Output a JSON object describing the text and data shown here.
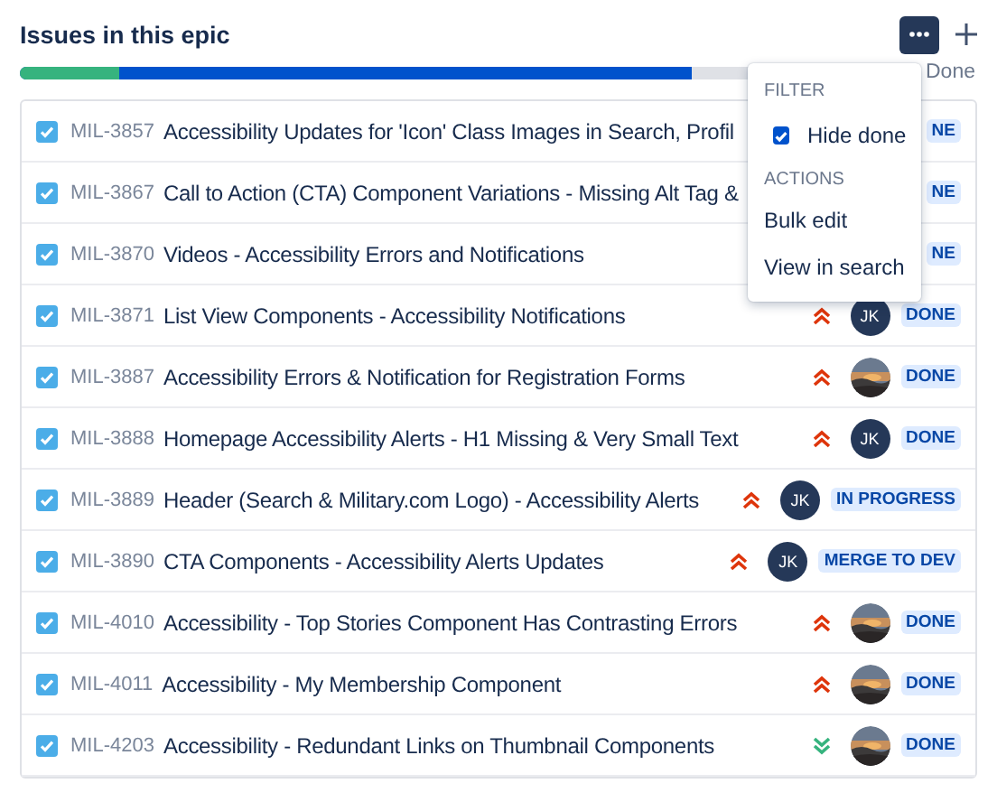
{
  "title": "Issues in this epic",
  "progress": {
    "segments": [
      {
        "kind": "done",
        "level": 0.12
      },
      {
        "kind": "in_progress",
        "level": 0.81
      }
    ],
    "label": "Done"
  },
  "issues": [
    {
      "key": "MIL-3857",
      "summary": "Accessibility Updates for 'Icon' Class Images in Search, Profil",
      "checked": true,
      "status": "NE"
    },
    {
      "key": "MIL-3867",
      "summary": "Call to Action (CTA) Component Variations - Missing Alt Tag &",
      "checked": true,
      "status": "NE"
    },
    {
      "key": "MIL-3870",
      "summary": "Videos - Accessibility Errors and Notifications",
      "checked": true,
      "status": "NE"
    },
    {
      "key": "MIL-3871",
      "summary": "List View Components - Accessibility Notifications",
      "checked": true,
      "priority": {
        "kind": "highest"
      },
      "avatar": {
        "kind": "initials",
        "initials": "JK"
      },
      "status": "DONE"
    },
    {
      "key": "MIL-3887",
      "summary": "Accessibility Errors & Notification for Registration Forms",
      "checked": true,
      "priority": {
        "kind": "highest"
      },
      "status": "DONE"
    },
    {
      "key": "MIL-3888",
      "summary": "Homepage Accessibility Alerts - H1 Missing & Very Small Text",
      "checked": true,
      "priority": {
        "kind": "highest"
      },
      "avatar": {
        "kind": "initials",
        "initials": "JK"
      },
      "status": "DONE"
    },
    {
      "key": "MIL-3889",
      "summary": "Header (Search & Military.com Logo) - Accessibility Alerts",
      "checked": true,
      "priority": {
        "kind": "highest"
      },
      "avatar": {
        "kind": "initials",
        "initials": "JK"
      },
      "status": "IN PROGRESS"
    },
    {
      "key": "MIL-3890",
      "summary": "CTA Components - Accessibility Alerts Updates",
      "checked": true,
      "priority": {
        "kind": "highest"
      },
      "avatar": {
        "kind": "initials",
        "initials": "JK"
      },
      "status": "MERGE TO DEV"
    },
    {
      "key": "MIL-4010",
      "summary": "Accessibility - Top Stories Component Has Contrasting Errors",
      "checked": true,
      "priority": {
        "kind": "highest"
      },
      "status": "DONE"
    },
    {
      "key": "MIL-4011",
      "summary": "Accessibility - My Membership Component",
      "checked": true,
      "priority": {
        "kind": "highest"
      },
      "status": "DONE"
    },
    {
      "key": "MIL-4203",
      "summary": "Accessibility - Redundant Links on Thumbnail Components",
      "checked": true,
      "priority": {
        "kind": "lowest"
      },
      "status": "DONE"
    }
  ],
  "menu": {
    "sections": [
      {
        "heading": "FILTER",
        "items": [
          {
            "kind": "checkbox",
            "label": "Hide done",
            "checked": true
          }
        ]
      },
      {
        "heading": "ACTIONS",
        "items": [
          {
            "kind": "action",
            "label": "Bulk edit"
          },
          {
            "kind": "action",
            "label": "View in search"
          }
        ]
      }
    ]
  }
}
